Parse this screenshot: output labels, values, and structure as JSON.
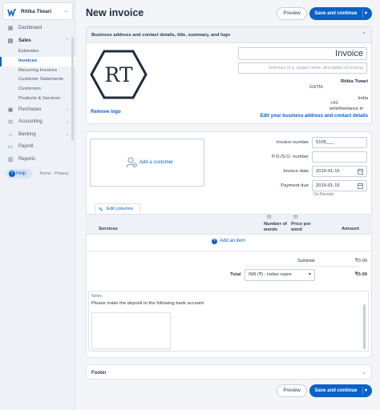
{
  "sidebar": {
    "user_name": "Ritika Tiwari",
    "items": [
      {
        "label": "Dashboard",
        "icon": "dashboard-icon"
      },
      {
        "label": "Sales",
        "icon": "sales-icon"
      },
      {
        "label": "Purchases",
        "icon": "purchases-icon"
      },
      {
        "label": "Accounting",
        "icon": "accounting-icon"
      },
      {
        "label": "Banking",
        "icon": "banking-icon"
      },
      {
        "label": "Payroll",
        "icon": "payroll-icon"
      },
      {
        "label": "Reports",
        "icon": "reports-icon"
      }
    ],
    "sales_sub": [
      "Estimates",
      "Invoices",
      "Recurring Invoices",
      "Customer Statements",
      "Customers",
      "Products & Services"
    ],
    "active_sub": "Invoices",
    "help": "Help",
    "terms": "Terms",
    "privacy": "Privacy",
    "legal_sep": "·"
  },
  "header": {
    "title": "New invoice",
    "preview_label": "Preview",
    "save_label": "Save and continue"
  },
  "business": {
    "section_title": "Business address and contact details, title, summary, and logo",
    "logo_text": "RT",
    "remove_logo": "Remove logo",
    "invoice_title": "Invoice",
    "summary_placeholder": "Summary (e.g. project name, description of invoice)",
    "name": "Ritika Tiwari",
    "gstn_label": "GSTN:",
    "country": "India",
    "phone": "+91",
    "website": "writefreelance.in",
    "edit_link": "Edit your business address and contact details"
  },
  "details": {
    "add_customer": "Add a customer",
    "invoice_number_label": "Invoice number",
    "invoice_number": "5105___",
    "po_label": "P.O./S.O. number",
    "po_value": "",
    "invoice_date_label": "Invoice date",
    "invoice_date": "2019-01-15",
    "payment_due_label": "Payment due",
    "payment_due": "2019-01-15",
    "on_receipt": "On Receipt",
    "edit_columns": "Edit columns"
  },
  "items": {
    "col_services": "Services",
    "col_words": "Number of words",
    "col_price": "Price per word",
    "col_amount": "Amount",
    "add_item": "Add an item",
    "subtotal_label": "Subtotal",
    "subtotal": "₹0.00",
    "total_label": "Total",
    "currency": "INR (₹) - Indian rupee",
    "total": "₹0.00"
  },
  "notes": {
    "label": "Notes",
    "text": "Please make the deposit to the following bank account:"
  },
  "footer": {
    "title": "Footer"
  },
  "colors": {
    "accent": "#0a61c7",
    "sidebar_bg": "#eef2f7"
  }
}
